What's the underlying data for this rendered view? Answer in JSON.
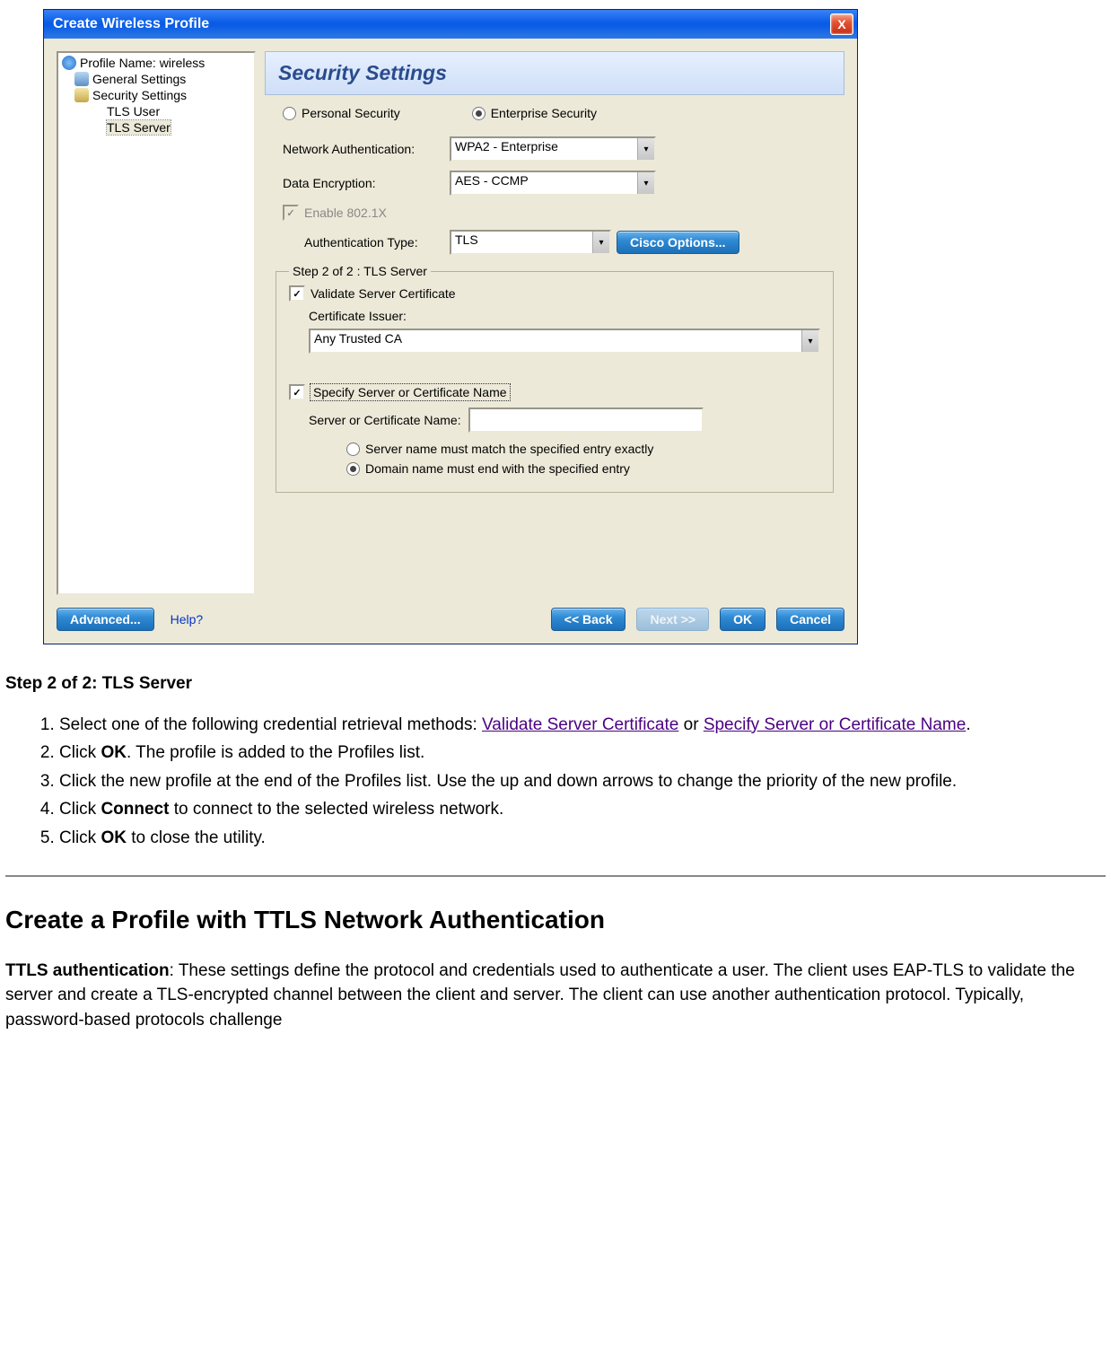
{
  "dialog": {
    "title": "Create Wireless Profile",
    "close_symbol": "X",
    "tree": {
      "items": [
        {
          "label": "Profile Name: wireless",
          "icon": "globe-icon",
          "indent": 0
        },
        {
          "label": "General Settings",
          "icon": "user-icon",
          "indent": 1
        },
        {
          "label": "Security Settings",
          "icon": "lock-icon",
          "indent": 1
        },
        {
          "label": "TLS User",
          "icon": "",
          "indent": 2
        },
        {
          "label": "TLS Server",
          "icon": "",
          "indent": 2
        }
      ],
      "selected_index": 4
    },
    "panel": {
      "heading": "Security Settings",
      "security_type": {
        "personal_label": "Personal Security",
        "enterprise_label": "Enterprise Security",
        "selected": "enterprise"
      },
      "fields": {
        "network_auth_label": "Network Authentication:",
        "network_auth_value": "WPA2 - Enterprise",
        "data_enc_label": "Data Encryption:",
        "data_enc_value": "AES - CCMP",
        "enable_8021x_label": "Enable 802.1X",
        "enable_8021x_checked": true,
        "auth_type_label": "Authentication Type:",
        "auth_type_value": "TLS",
        "cisco_button": "Cisco Options..."
      },
      "group": {
        "legend": "Step 2 of 2 : TLS Server",
        "validate_cert_label": "Validate Server Certificate",
        "validate_cert_checked": true,
        "cert_issuer_label": "Certificate Issuer:",
        "cert_issuer_value": "Any Trusted CA",
        "specify_server_label": "Specify Server or Certificate Name",
        "specify_server_checked": true,
        "server_name_label": "Server or Certificate Name:",
        "server_name_value": "",
        "match_exact_label": "Server name must match the specified entry exactly",
        "match_domain_label": "Domain name must end with the specified entry",
        "match_selected": "domain"
      }
    },
    "footer": {
      "advanced": "Advanced...",
      "help": "Help?",
      "back": "<< Back",
      "next": "Next >>",
      "ok": "OK",
      "cancel": "Cancel"
    }
  },
  "doc": {
    "step_heading": "Step 2 of 2: TLS Server",
    "ol": [
      {
        "pre": "Select one of the following credential retrieval methods: ",
        "link1": "Validate Server Certificate",
        "mid": " or ",
        "link2": "Specify Server or Certificate Name",
        "post": "."
      },
      {
        "pre": "Click ",
        "bold": "OK",
        "post": ". The profile is added to the Profiles list."
      },
      {
        "text": "Click the new profile at the end of the Profiles list. Use the up and down arrows to change the priority of the new profile."
      },
      {
        "pre": "Click ",
        "bold": "Connect",
        "post": " to connect to the selected wireless network."
      },
      {
        "pre": "Click ",
        "bold": "OK",
        "post": " to close the utility."
      }
    ],
    "section_heading": "Create a Profile with TTLS Network Authentication",
    "ttls_bold": "TTLS authentication",
    "ttls_body": ": These settings define the protocol and credentials used to authenticate a user. The client uses EAP-TLS to validate the server and create a TLS-encrypted channel between the client and server. The client can use another authentication protocol. Typically, password-based protocols challenge"
  }
}
